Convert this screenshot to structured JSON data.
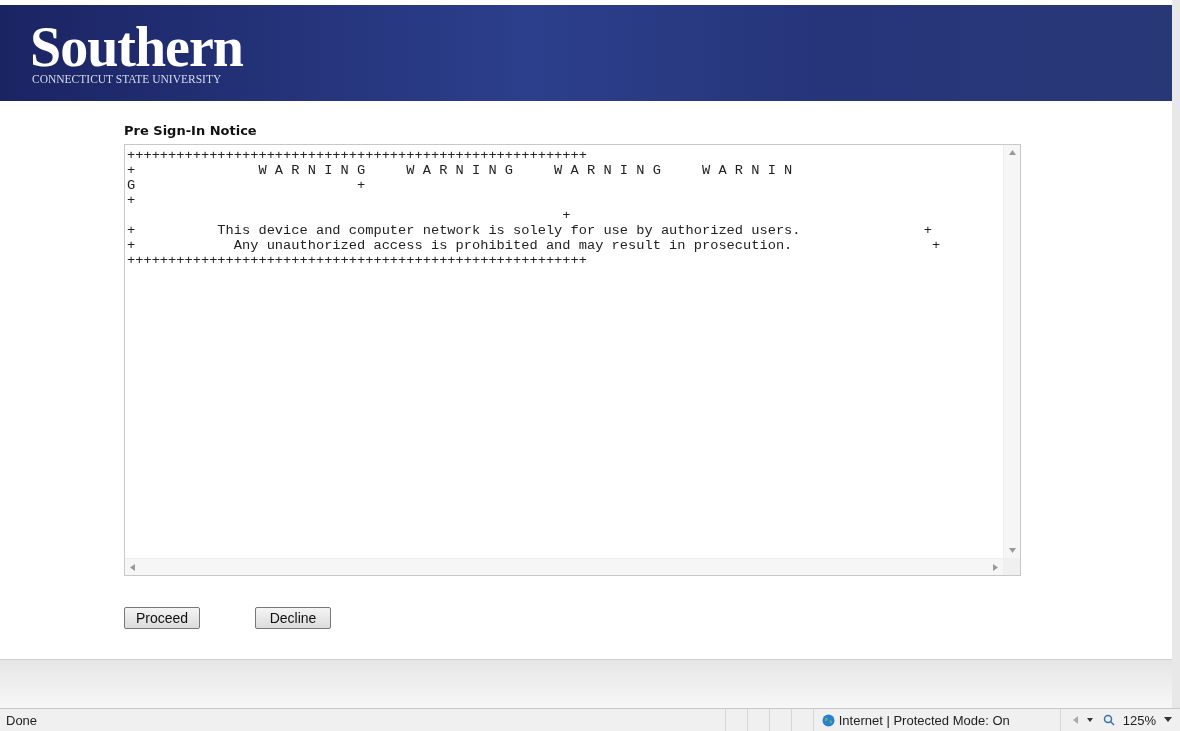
{
  "banner": {
    "logo_word": "Southern",
    "logo_subtitle": "CONNECTICUT STATE UNIVERSITY"
  },
  "notice": {
    "title": "Pre Sign-In Notice",
    "lines": [
      "++++++++++++++++++++++++++++++++++++++++++++++++++++++++",
      "+               W A R N I N G     W A R N I N G     W A R N I N G     W A R N I N",
      "G                           +",
      "+",
      "                                                     +",
      "+          This device and computer network is solely for use by authorized users.               +",
      "+            Any unauthorized access is prohibited and may result in prosecution.                 +",
      "++++++++++++++++++++++++++++++++++++++++++++++++++++++++"
    ]
  },
  "buttons": [
    {
      "label": "Proceed"
    },
    {
      "label": "Decline"
    }
  ],
  "status_bar": {
    "status": "Done",
    "zone": "Internet | Protected Mode: On",
    "zoom": "125%"
  }
}
